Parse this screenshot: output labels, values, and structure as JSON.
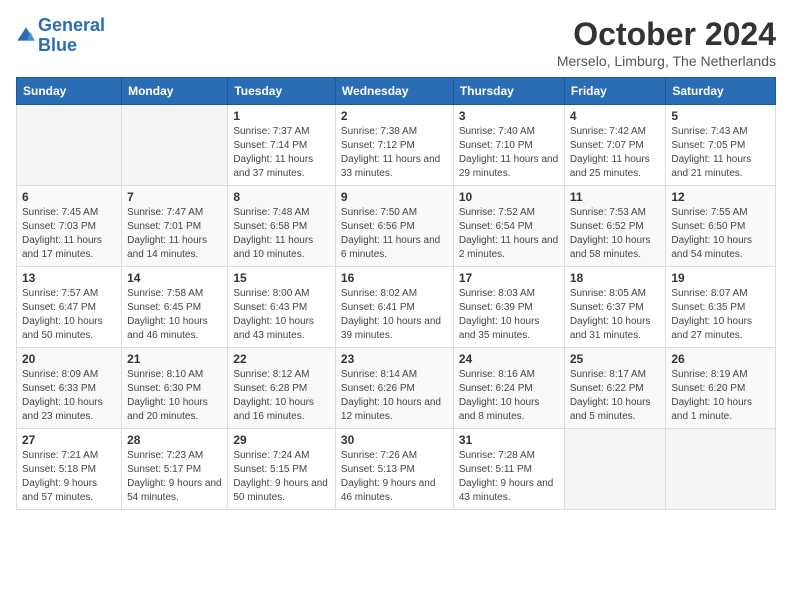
{
  "logo": {
    "line1": "General",
    "line2": "Blue"
  },
  "title": "October 2024",
  "subtitle": "Merselo, Limburg, The Netherlands",
  "weekdays": [
    "Sunday",
    "Monday",
    "Tuesday",
    "Wednesday",
    "Thursday",
    "Friday",
    "Saturday"
  ],
  "weeks": [
    [
      {
        "day": "",
        "info": ""
      },
      {
        "day": "",
        "info": ""
      },
      {
        "day": "1",
        "info": "Sunrise: 7:37 AM\nSunset: 7:14 PM\nDaylight: 11 hours and 37 minutes."
      },
      {
        "day": "2",
        "info": "Sunrise: 7:38 AM\nSunset: 7:12 PM\nDaylight: 11 hours and 33 minutes."
      },
      {
        "day": "3",
        "info": "Sunrise: 7:40 AM\nSunset: 7:10 PM\nDaylight: 11 hours and 29 minutes."
      },
      {
        "day": "4",
        "info": "Sunrise: 7:42 AM\nSunset: 7:07 PM\nDaylight: 11 hours and 25 minutes."
      },
      {
        "day": "5",
        "info": "Sunrise: 7:43 AM\nSunset: 7:05 PM\nDaylight: 11 hours and 21 minutes."
      }
    ],
    [
      {
        "day": "6",
        "info": "Sunrise: 7:45 AM\nSunset: 7:03 PM\nDaylight: 11 hours and 17 minutes."
      },
      {
        "day": "7",
        "info": "Sunrise: 7:47 AM\nSunset: 7:01 PM\nDaylight: 11 hours and 14 minutes."
      },
      {
        "day": "8",
        "info": "Sunrise: 7:48 AM\nSunset: 6:58 PM\nDaylight: 11 hours and 10 minutes."
      },
      {
        "day": "9",
        "info": "Sunrise: 7:50 AM\nSunset: 6:56 PM\nDaylight: 11 hours and 6 minutes."
      },
      {
        "day": "10",
        "info": "Sunrise: 7:52 AM\nSunset: 6:54 PM\nDaylight: 11 hours and 2 minutes."
      },
      {
        "day": "11",
        "info": "Sunrise: 7:53 AM\nSunset: 6:52 PM\nDaylight: 10 hours and 58 minutes."
      },
      {
        "day": "12",
        "info": "Sunrise: 7:55 AM\nSunset: 6:50 PM\nDaylight: 10 hours and 54 minutes."
      }
    ],
    [
      {
        "day": "13",
        "info": "Sunrise: 7:57 AM\nSunset: 6:47 PM\nDaylight: 10 hours and 50 minutes."
      },
      {
        "day": "14",
        "info": "Sunrise: 7:58 AM\nSunset: 6:45 PM\nDaylight: 10 hours and 46 minutes."
      },
      {
        "day": "15",
        "info": "Sunrise: 8:00 AM\nSunset: 6:43 PM\nDaylight: 10 hours and 43 minutes."
      },
      {
        "day": "16",
        "info": "Sunrise: 8:02 AM\nSunset: 6:41 PM\nDaylight: 10 hours and 39 minutes."
      },
      {
        "day": "17",
        "info": "Sunrise: 8:03 AM\nSunset: 6:39 PM\nDaylight: 10 hours and 35 minutes."
      },
      {
        "day": "18",
        "info": "Sunrise: 8:05 AM\nSunset: 6:37 PM\nDaylight: 10 hours and 31 minutes."
      },
      {
        "day": "19",
        "info": "Sunrise: 8:07 AM\nSunset: 6:35 PM\nDaylight: 10 hours and 27 minutes."
      }
    ],
    [
      {
        "day": "20",
        "info": "Sunrise: 8:09 AM\nSunset: 6:33 PM\nDaylight: 10 hours and 23 minutes."
      },
      {
        "day": "21",
        "info": "Sunrise: 8:10 AM\nSunset: 6:30 PM\nDaylight: 10 hours and 20 minutes."
      },
      {
        "day": "22",
        "info": "Sunrise: 8:12 AM\nSunset: 6:28 PM\nDaylight: 10 hours and 16 minutes."
      },
      {
        "day": "23",
        "info": "Sunrise: 8:14 AM\nSunset: 6:26 PM\nDaylight: 10 hours and 12 minutes."
      },
      {
        "day": "24",
        "info": "Sunrise: 8:16 AM\nSunset: 6:24 PM\nDaylight: 10 hours and 8 minutes."
      },
      {
        "day": "25",
        "info": "Sunrise: 8:17 AM\nSunset: 6:22 PM\nDaylight: 10 hours and 5 minutes."
      },
      {
        "day": "26",
        "info": "Sunrise: 8:19 AM\nSunset: 6:20 PM\nDaylight: 10 hours and 1 minute."
      }
    ],
    [
      {
        "day": "27",
        "info": "Sunrise: 7:21 AM\nSunset: 5:18 PM\nDaylight: 9 hours and 57 minutes."
      },
      {
        "day": "28",
        "info": "Sunrise: 7:23 AM\nSunset: 5:17 PM\nDaylight: 9 hours and 54 minutes."
      },
      {
        "day": "29",
        "info": "Sunrise: 7:24 AM\nSunset: 5:15 PM\nDaylight: 9 hours and 50 minutes."
      },
      {
        "day": "30",
        "info": "Sunrise: 7:26 AM\nSunset: 5:13 PM\nDaylight: 9 hours and 46 minutes."
      },
      {
        "day": "31",
        "info": "Sunrise: 7:28 AM\nSunset: 5:11 PM\nDaylight: 9 hours and 43 minutes."
      },
      {
        "day": "",
        "info": ""
      },
      {
        "day": "",
        "info": ""
      }
    ]
  ]
}
